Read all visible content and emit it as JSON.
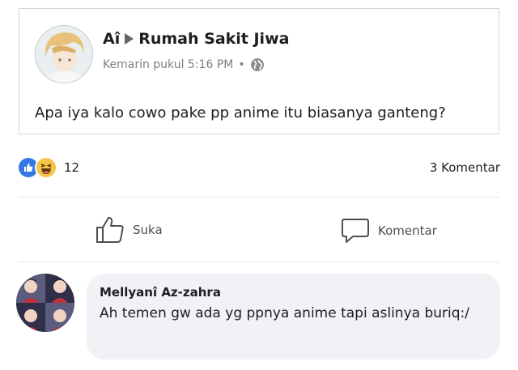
{
  "post": {
    "author": "Aî",
    "group": "Rumah Sakit Jiwa",
    "timestamp": "Kemarin pukul 5:16 PM",
    "separator": "•",
    "privacy_icon": "globe-icon",
    "text": "Apa iya kalo cowo pake pp anime itu biasanya ganteng?"
  },
  "engagement": {
    "reactions": [
      "like-icon",
      "haha-icon"
    ],
    "reaction_count": "12",
    "comment_count": "3 Komentar"
  },
  "actions": {
    "like_label": "Suka",
    "comment_label": "Komentar"
  },
  "comment": {
    "author": "Mellyanî Az-zahra",
    "text": "Ah temen gw ada yg ppnya anime tapi aslinya buriq:/"
  },
  "colors": {
    "like_blue": "#3578e5",
    "haha_yellow": "#f7c44a",
    "bubble_bg": "#f0f2f5",
    "muted_text": "#7a7f87"
  }
}
